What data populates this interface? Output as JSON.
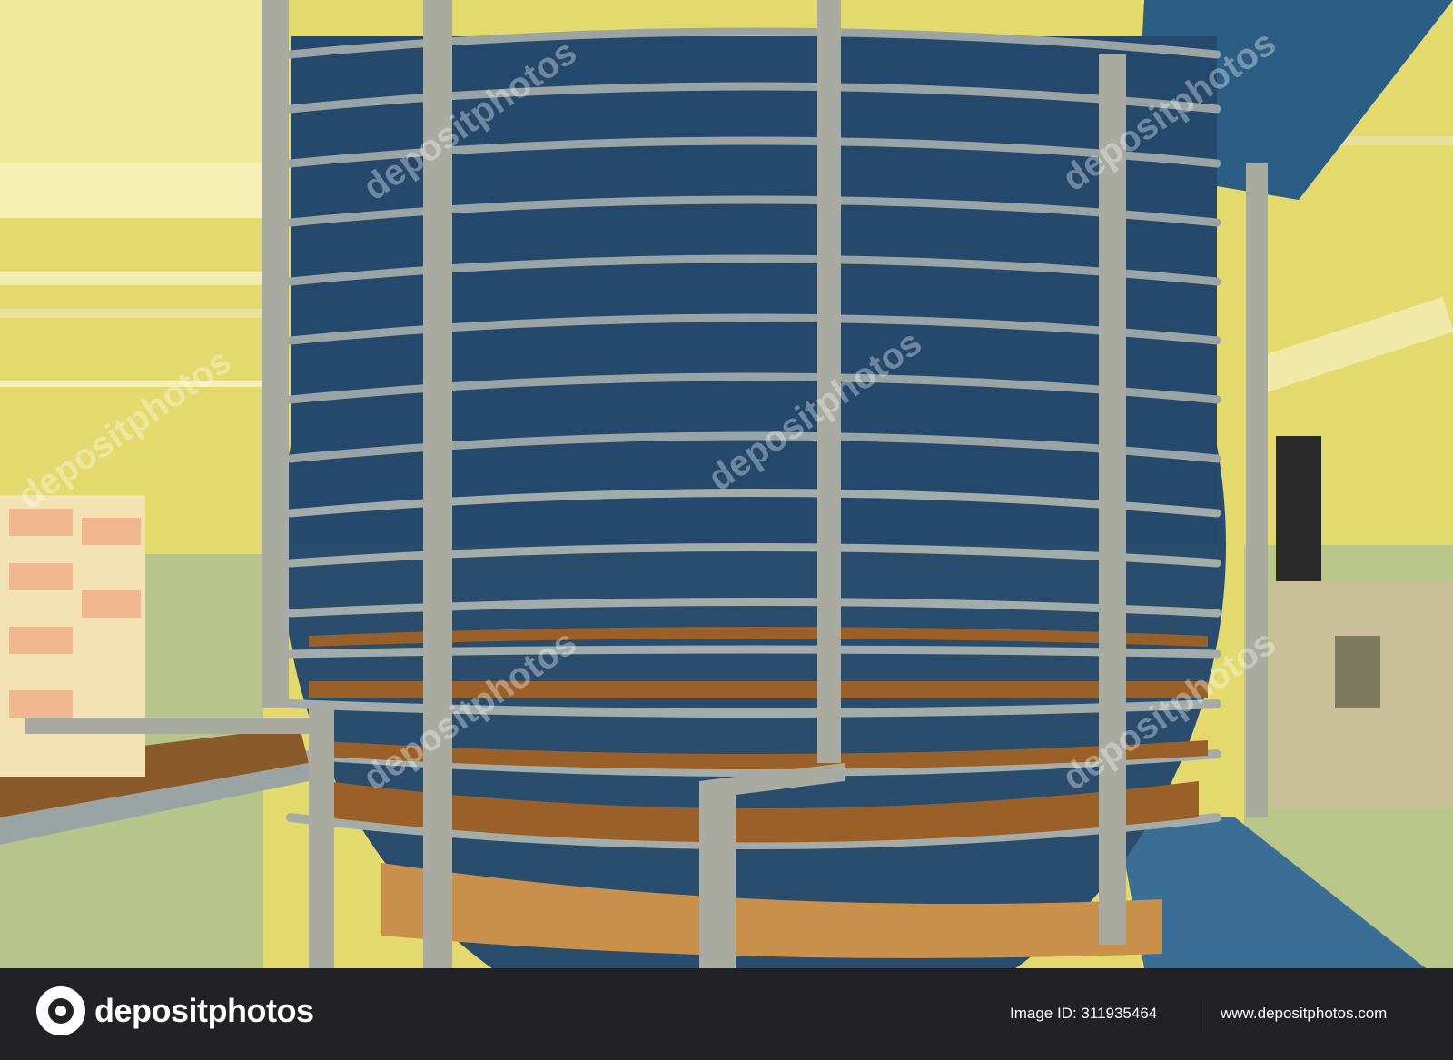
{
  "photo": {
    "description_icon": "spiral-conveyor-cooling-tower-photo",
    "colors": {
      "wall": "#e5db70",
      "belt_blue": "#2e5f86",
      "frame": "#a8a8a0",
      "cookie": "#a0652a"
    }
  },
  "watermark": {
    "text": "depositphotos"
  },
  "footer": {
    "logo_text": "depositphotos",
    "image_id": "Image ID: 311935464",
    "website": "www.depositphotos.com"
  }
}
